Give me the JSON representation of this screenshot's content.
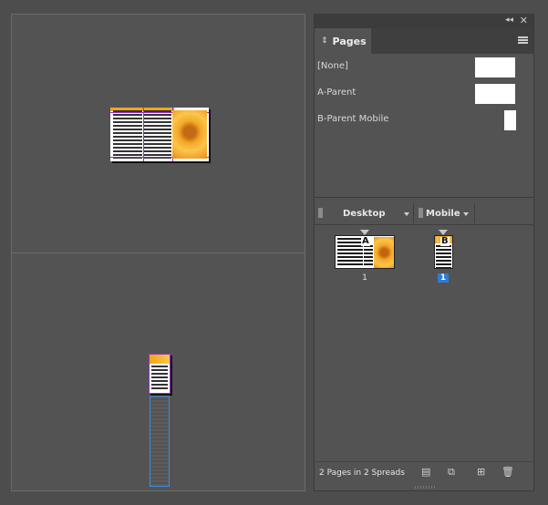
{
  "panel": {
    "tab_label": "Pages",
    "parents": [
      {
        "label": "[None]"
      },
      {
        "label": "A-Parent"
      },
      {
        "label": "B-Parent Mobile"
      }
    ],
    "alternates": [
      {
        "name": "Desktop"
      },
      {
        "name": "Mobile"
      }
    ],
    "pages": [
      {
        "number": "1",
        "badge": "A",
        "selected": false
      },
      {
        "number": "1",
        "badge": "B",
        "selected": true
      }
    ],
    "status": "2 Pages in 2 Spreads"
  },
  "icons": {
    "collapse": "double-chevron-left-icon",
    "close": "close-icon",
    "tab": "up-down-arrows-icon",
    "menu": "hamburger-menu-icon",
    "footer": [
      "edit-page-size-icon",
      "create-alternate-layout-icon",
      "new-page-icon",
      "trash-icon"
    ]
  },
  "colors": {
    "selection_blue": "#2e7bd6",
    "guide_purple": "#9b2bd6",
    "image_orange": "#f2a928"
  }
}
